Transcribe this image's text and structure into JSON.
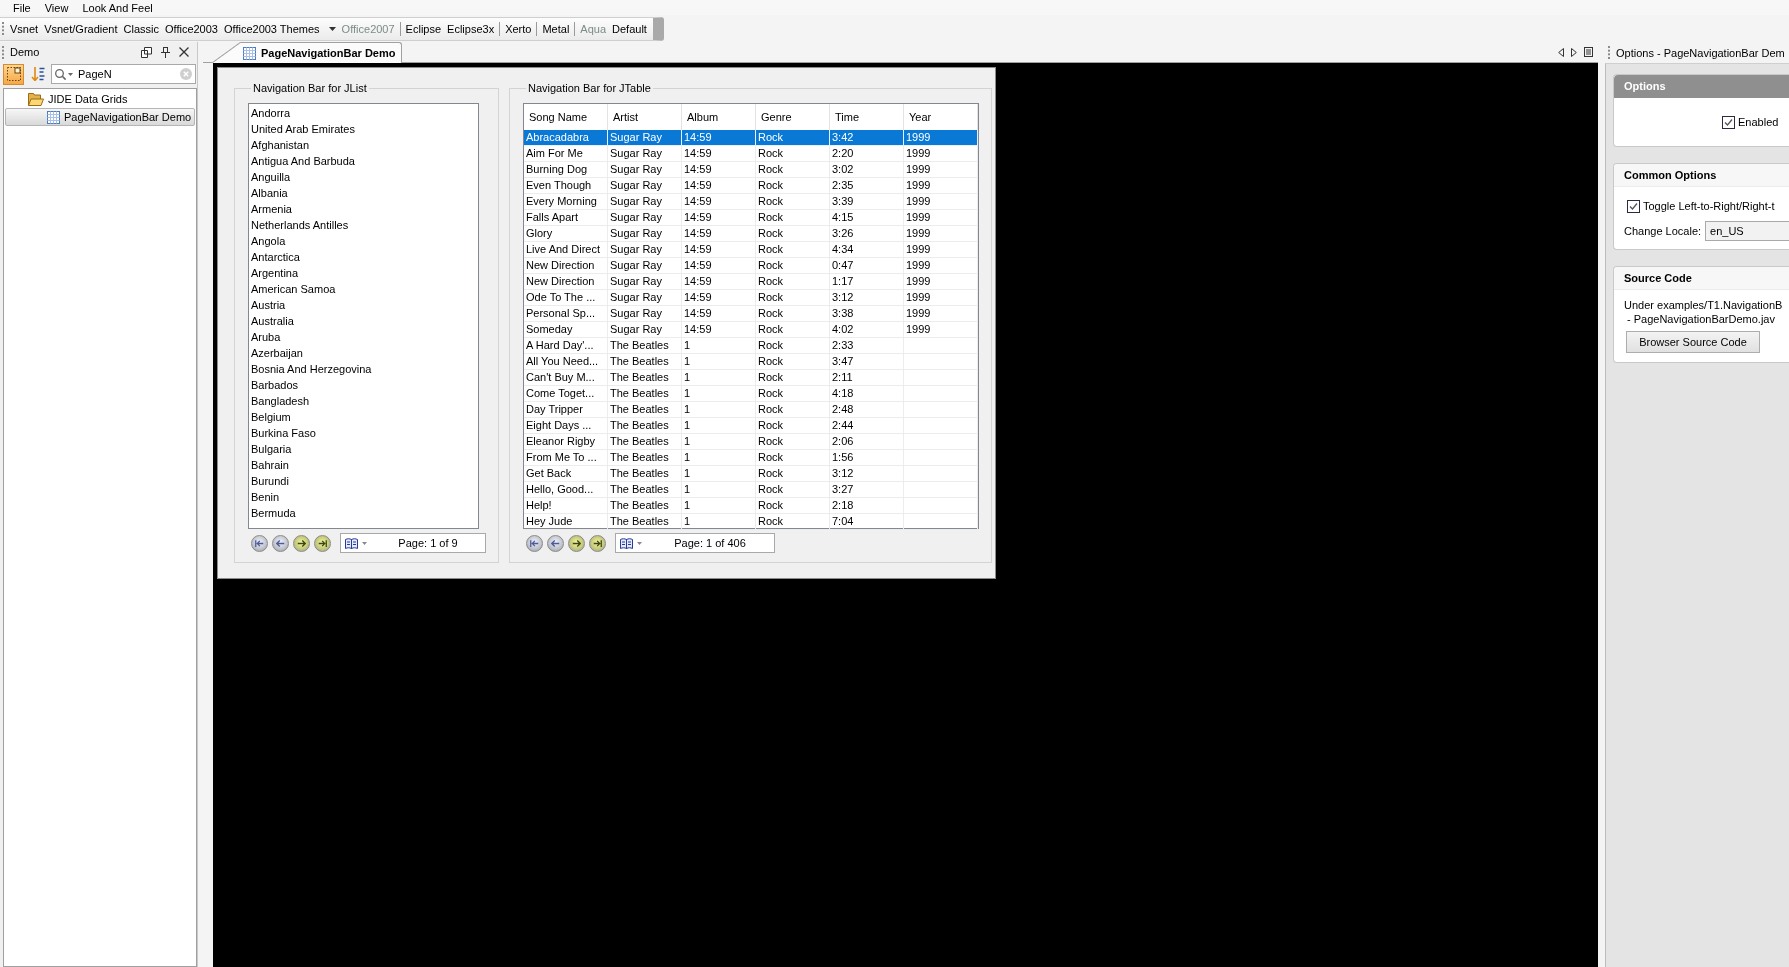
{
  "menu_bar": [
    "File",
    "View",
    "Look And Feel"
  ],
  "toolbar": {
    "items": [
      {
        "kind": "button",
        "label": "Vsnet",
        "disabled": false
      },
      {
        "kind": "button",
        "label": "Vsnet/Gradient",
        "disabled": false
      },
      {
        "kind": "button",
        "label": "Classic",
        "disabled": false
      },
      {
        "kind": "button",
        "label": "Office2003",
        "disabled": false
      },
      {
        "kind": "dropdown",
        "label": "Office2003 Themes",
        "disabled": false
      },
      {
        "kind": "button",
        "label": "Office2007",
        "disabled": true
      },
      {
        "kind": "separator"
      },
      {
        "kind": "button",
        "label": "Eclipse",
        "disabled": false
      },
      {
        "kind": "button",
        "label": "Eclipse3x",
        "disabled": false
      },
      {
        "kind": "separator"
      },
      {
        "kind": "button",
        "label": "Xerto",
        "disabled": false
      },
      {
        "kind": "separator"
      },
      {
        "kind": "button",
        "label": "Metal",
        "disabled": false
      },
      {
        "kind": "separator"
      },
      {
        "kind": "button",
        "label": "Aqua",
        "disabled": true
      },
      {
        "kind": "button",
        "label": "Default",
        "disabled": false
      }
    ]
  },
  "sidebar": {
    "title": "Demo",
    "tools": [
      {
        "kind": "frame",
        "selected": true
      },
      {
        "kind": "sort",
        "selected": false
      }
    ],
    "search": {
      "value": "PageN"
    },
    "tree": [
      {
        "label": "JIDE Data Grids",
        "expanded": true,
        "selected": false,
        "children": [
          {
            "label": "PageNavigationBar Demo",
            "selected": true
          }
        ]
      }
    ]
  },
  "document_tabs": [
    {
      "label": "PageNavigationBar Demo",
      "selected": true
    }
  ],
  "demo": {
    "list_group": {
      "title": "Navigation Bar for JList",
      "items": [
        {
          "label": "Andorra",
          "selected": false
        },
        {
          "label": "United Arab Emirates",
          "selected": false
        },
        {
          "label": "Afghanistan",
          "selected": false
        },
        {
          "label": "Antigua And Barbuda",
          "selected": false
        },
        {
          "label": "Anguilla",
          "selected": false
        },
        {
          "label": "Albania",
          "selected": false
        },
        {
          "label": "Armenia",
          "selected": false
        },
        {
          "label": "Netherlands Antilles",
          "selected": false
        },
        {
          "label": "Angola",
          "selected": false
        },
        {
          "label": "Antarctica",
          "selected": false
        },
        {
          "label": "Argentina",
          "selected": false
        },
        {
          "label": "American Samoa",
          "selected": false
        },
        {
          "label": "Austria",
          "selected": false
        },
        {
          "label": "Australia",
          "selected": false
        },
        {
          "label": "Aruba",
          "selected": false
        },
        {
          "label": "Azerbaijan",
          "selected": false
        },
        {
          "label": "Bosnia And Herzegovina",
          "selected": false
        },
        {
          "label": "Barbados",
          "selected": false
        },
        {
          "label": "Bangladesh",
          "selected": false
        },
        {
          "label": "Belgium",
          "selected": false
        },
        {
          "label": "Burkina Faso",
          "selected": false
        },
        {
          "label": "Bulgaria",
          "selected": false
        },
        {
          "label": "Bahrain",
          "selected": false
        },
        {
          "label": "Burundi",
          "selected": false
        },
        {
          "label": "Benin",
          "selected": false
        },
        {
          "label": "Bermuda",
          "selected": false
        }
      ],
      "navigation": {
        "buttons": [
          {
            "kind": "first",
            "disabled": true
          },
          {
            "kind": "previous",
            "disabled": true
          },
          {
            "kind": "next",
            "disabled": false
          },
          {
            "kind": "last",
            "disabled": false
          }
        ],
        "page_label": "Page: 1 of 9"
      }
    },
    "table_group": {
      "title": "Navigation Bar for JTable",
      "columns": [
        "Song Name",
        "Artist",
        "Album",
        "Genre",
        "Time",
        "Year"
      ],
      "rows": [
        {
          "selected": true,
          "cells": [
            "Abracadabra",
            "Sugar Ray",
            "14:59",
            "Rock",
            "3:42",
            "1999"
          ]
        },
        {
          "selected": false,
          "cells": [
            "Aim For Me",
            "Sugar Ray",
            "14:59",
            "Rock",
            "2:20",
            "1999"
          ]
        },
        {
          "selected": false,
          "cells": [
            "Burning Dog",
            "Sugar Ray",
            "14:59",
            "Rock",
            "3:02",
            "1999"
          ]
        },
        {
          "selected": false,
          "cells": [
            "Even Though",
            "Sugar Ray",
            "14:59",
            "Rock",
            "2:35",
            "1999"
          ]
        },
        {
          "selected": false,
          "cells": [
            "Every Morning",
            "Sugar Ray",
            "14:59",
            "Rock",
            "3:39",
            "1999"
          ]
        },
        {
          "selected": false,
          "cells": [
            "Falls Apart",
            "Sugar Ray",
            "14:59",
            "Rock",
            "4:15",
            "1999"
          ]
        },
        {
          "selected": false,
          "cells": [
            "Glory",
            "Sugar Ray",
            "14:59",
            "Rock",
            "3:26",
            "1999"
          ]
        },
        {
          "selected": false,
          "cells": [
            "Live And Direct",
            "Sugar Ray",
            "14:59",
            "Rock",
            "4:34",
            "1999"
          ]
        },
        {
          "selected": false,
          "cells": [
            "New Direction",
            "Sugar Ray",
            "14:59",
            "Rock",
            "0:47",
            "1999"
          ]
        },
        {
          "selected": false,
          "cells": [
            "New Direction",
            "Sugar Ray",
            "14:59",
            "Rock",
            "1:17",
            "1999"
          ]
        },
        {
          "selected": false,
          "cells": [
            "Ode To The ...",
            "Sugar Ray",
            "14:59",
            "Rock",
            "3:12",
            "1999"
          ]
        },
        {
          "selected": false,
          "cells": [
            "Personal Sp...",
            "Sugar Ray",
            "14:59",
            "Rock",
            "3:38",
            "1999"
          ]
        },
        {
          "selected": false,
          "cells": [
            "Someday",
            "Sugar Ray",
            "14:59",
            "Rock",
            "4:02",
            "1999"
          ]
        },
        {
          "selected": false,
          "cells": [
            "A Hard Day'...",
            "The Beatles",
            "1",
            "Rock",
            "2:33"
          ]
        },
        {
          "selected": false,
          "cells": [
            "All You Need...",
            "The Beatles",
            "1",
            "Rock",
            "3:47"
          ]
        },
        {
          "selected": false,
          "cells": [
            "Can't Buy M...",
            "The Beatles",
            "1",
            "Rock",
            "2:11"
          ]
        },
        {
          "selected": false,
          "cells": [
            "Come Toget...",
            "The Beatles",
            "1",
            "Rock",
            "4:18"
          ]
        },
        {
          "selected": false,
          "cells": [
            "Day Tripper",
            "The Beatles",
            "1",
            "Rock",
            "2:48"
          ]
        },
        {
          "selected": false,
          "cells": [
            "Eight Days ...",
            "The Beatles",
            "1",
            "Rock",
            "2:44"
          ]
        },
        {
          "selected": false,
          "cells": [
            "Eleanor Rigby",
            "The Beatles",
            "1",
            "Rock",
            "2:06"
          ]
        },
        {
          "selected": false,
          "cells": [
            "From Me To ...",
            "The Beatles",
            "1",
            "Rock",
            "1:56"
          ]
        },
        {
          "selected": false,
          "cells": [
            "Get Back",
            "The Beatles",
            "1",
            "Rock",
            "3:12"
          ]
        },
        {
          "selected": false,
          "cells": [
            "Hello, Good...",
            "The Beatles",
            "1",
            "Rock",
            "3:27"
          ]
        },
        {
          "selected": false,
          "cells": [
            "Help!",
            "The Beatles",
            "1",
            "Rock",
            "2:18"
          ]
        },
        {
          "selected": false,
          "cells": [
            "Hey Jude",
            "The Beatles",
            "1",
            "Rock",
            "7:04"
          ]
        }
      ],
      "navigation": {
        "buttons": [
          {
            "kind": "first",
            "disabled": true
          },
          {
            "kind": "previous",
            "disabled": true
          },
          {
            "kind": "next",
            "disabled": false
          },
          {
            "kind": "last",
            "disabled": false
          }
        ],
        "page_label": "Page: 1 of 406"
      }
    }
  },
  "options_panel": {
    "title": "Options - PageNavigationBar Dem",
    "sections": [
      {
        "kind": "options",
        "title": "Options",
        "highlighted": true,
        "checkbox": {
          "label": "Enabled",
          "checked": true
        }
      },
      {
        "kind": "common",
        "title": "Common Options",
        "highlighted": false,
        "checkbox": {
          "label": "Toggle Left-to-Right/Right-t",
          "checked": true
        },
        "locale": {
          "label": "Change Locale:",
          "value": "en_US"
        }
      },
      {
        "kind": "source",
        "title": "Source Code",
        "highlighted": false,
        "lines": [
          "Under examples/T1.NavigationB",
          "- PageNavigationBarDemo.jav"
        ],
        "button": "Browser Source Code"
      }
    ]
  }
}
